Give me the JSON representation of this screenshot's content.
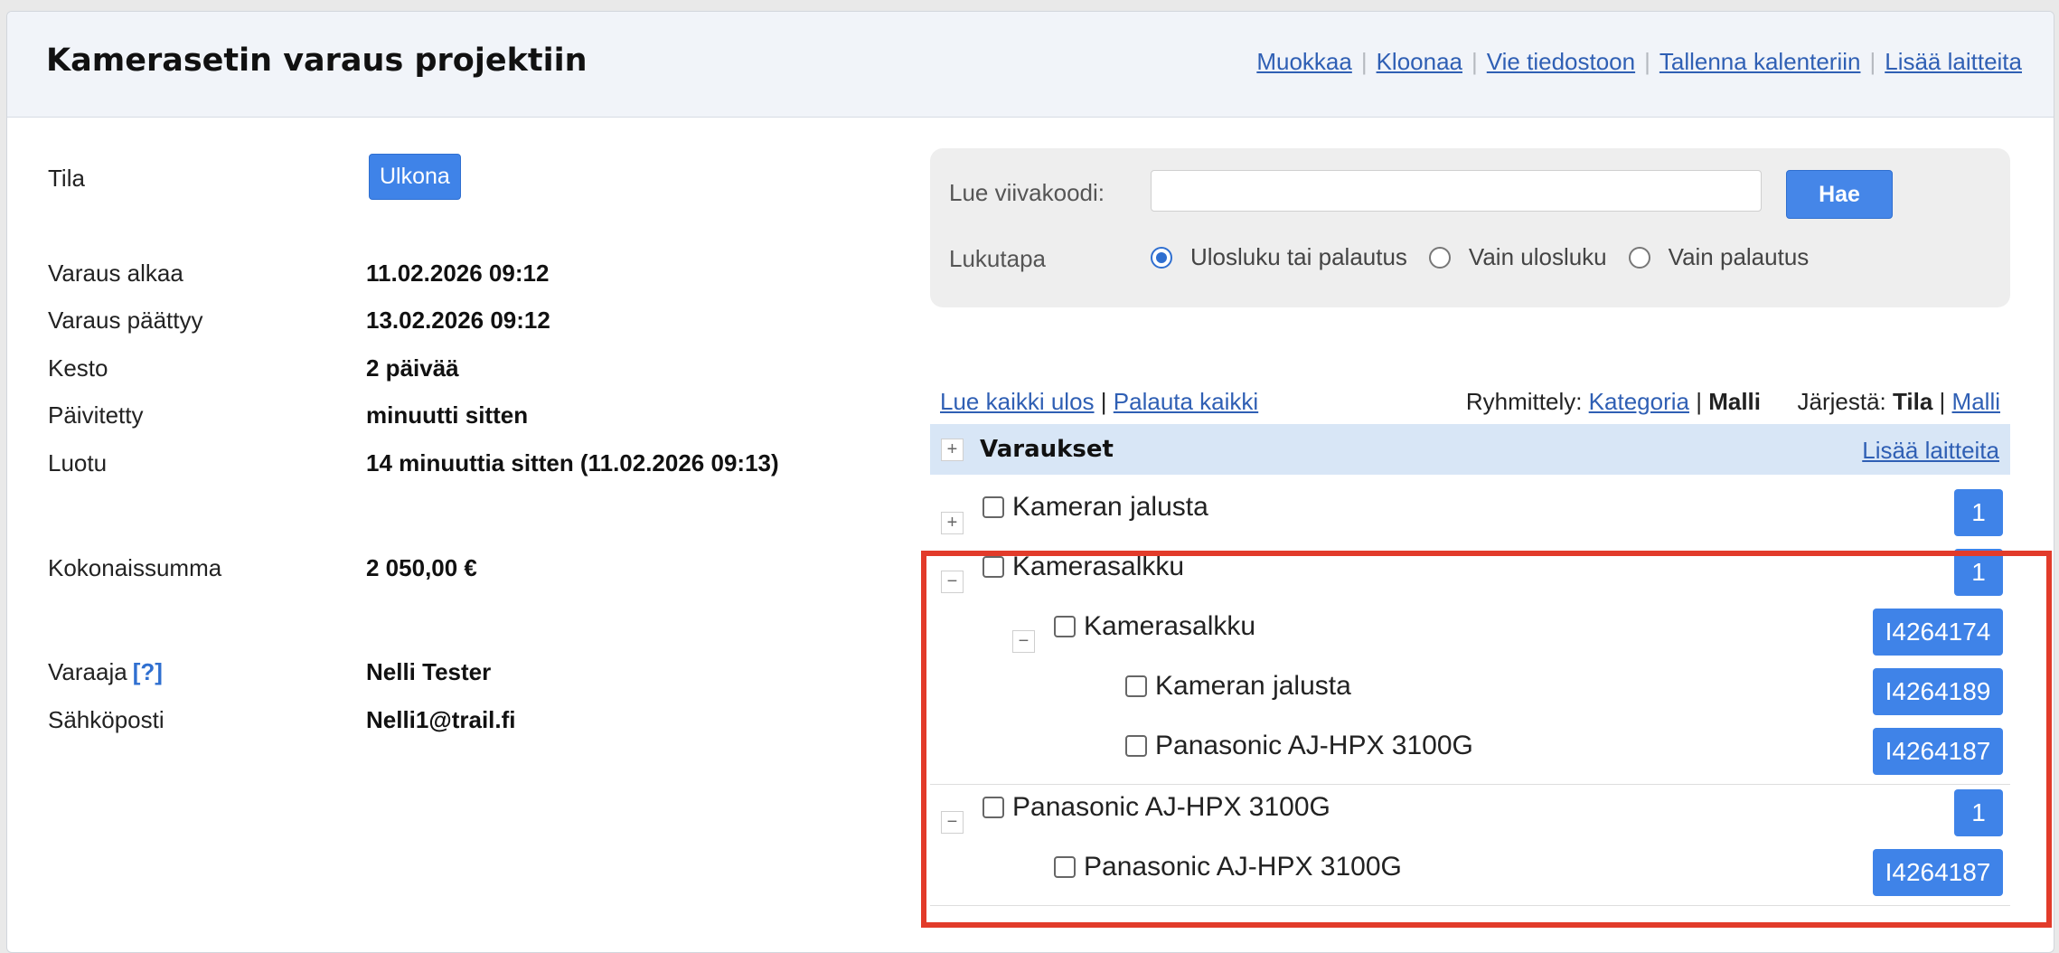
{
  "header": {
    "title": "Kamerasetin varaus projektiin",
    "actions": [
      "Muokkaa",
      "Kloonaa",
      "Vie tiedostoon",
      "Tallenna kalenteriin",
      "Lisää laitteita"
    ],
    "separator": "|"
  },
  "info": {
    "status_label": "Tila",
    "status_value": "Ulkona",
    "start_label": "Varaus alkaa",
    "start_value": "11.02.2026 09:12",
    "end_label": "Varaus päättyy",
    "end_value": "13.02.2026 09:12",
    "duration_label": "Kesto",
    "duration_value": "2 päivää",
    "updated_label": "Päivitetty",
    "updated_value": "minuutti sitten",
    "created_label": "Luotu",
    "created_value": "14 minuuttia sitten (11.02.2026 09:13)",
    "total_label": "Kokonaissumma",
    "total_value": "2 050,00 €",
    "booker_label": "Varaaja",
    "booker_help": "[?]",
    "booker_value": "Nelli Tester",
    "email_label": "Sähköposti",
    "email_value": "Nelli1@trail.fi"
  },
  "scan": {
    "barcode_label": "Lue viivakoodi:",
    "barcode_value": "",
    "search_label": "Hae",
    "mode_label": "Lukutapa",
    "modes": [
      "Ulosluku tai palautus",
      "Vain ulosluku",
      "Vain palautus"
    ],
    "selected_mode": "Ulosluku tai palautus"
  },
  "toolbar": {
    "checkout_all": "Lue kaikki ulos",
    "return_all": "Palauta kaikki",
    "sep": "|",
    "grouping_label": "Ryhmittely:",
    "grouping_category": "Kategoria",
    "grouping_model": "Malli",
    "sort_label": "Järjestä:",
    "sort_status": "Tila",
    "sort_model": "Malli"
  },
  "reservations": {
    "title": "Varaukset",
    "add_label": "Lisää laitteita",
    "toggle_plus": "+",
    "toggle_minus": "−",
    "items": [
      {
        "name": "Kameran jalusta",
        "badge": "1"
      },
      {
        "name": "Kamerasalkku",
        "badge": "1"
      },
      {
        "name": "Kamerasalkku",
        "badge": "I4264174"
      },
      {
        "name": "Kameran jalusta",
        "badge": "I4264189"
      },
      {
        "name": "Panasonic AJ-HPX 3100G",
        "badge": "I4264187"
      },
      {
        "name": "Panasonic AJ-HPX 3100G",
        "badge": "1"
      },
      {
        "name": "Panasonic AJ-HPX 3100G",
        "badge": "I4264187"
      }
    ]
  },
  "colors": {
    "accent": "#3f83e8",
    "link": "#2f5fb4",
    "highlight": "#e23b2a",
    "header_bg": "#f1f4f9",
    "group_bg": "#d8e6f6"
  }
}
